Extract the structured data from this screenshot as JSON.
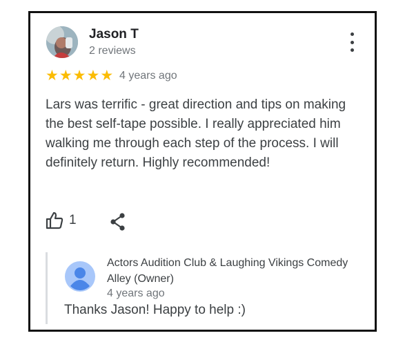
{
  "review": {
    "author_name": "Jason T",
    "author_meta": "2 reviews",
    "avatar_icon": "user-photo",
    "more_icon": "more-vert-icon",
    "rating": 5,
    "rating_max": 5,
    "stars": [
      "★",
      "★",
      "★",
      "★",
      "★"
    ],
    "star_color": "#fbbc04",
    "date": "4 years ago",
    "text": "Lars was terrific - great direction and tips on making the best self-tape possible. I really appreciated him walking me through each step of the process. I will definitely return. Highly recommended!",
    "like_icon": "thumb-up-icon",
    "like_count": "1",
    "share_icon": "share-icon"
  },
  "owner_reply": {
    "owner_name": "Actors Audition Club & Laughing Vikings Comedy Alley (Owner)",
    "date": "4 years ago",
    "text": "Thanks Jason! Happy to help :)",
    "avatar_icon": "person-avatar-icon",
    "avatar_color": "#4a86e8"
  }
}
